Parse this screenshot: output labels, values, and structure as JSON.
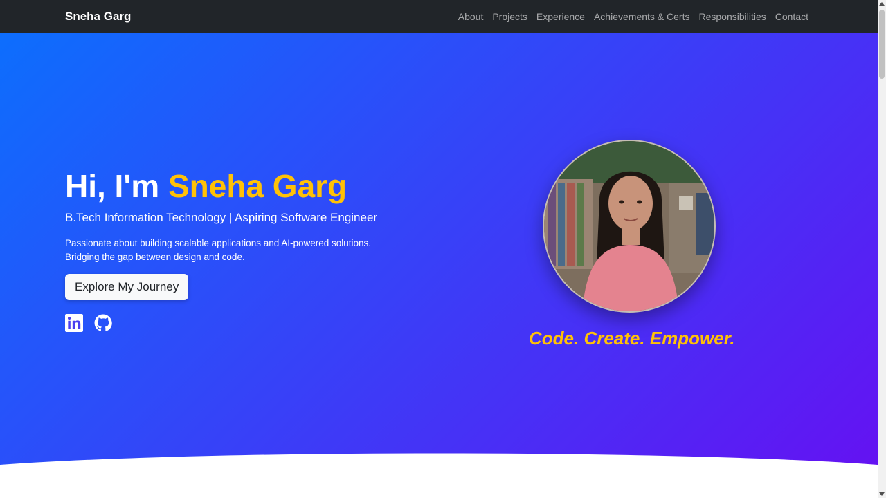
{
  "nav": {
    "brand": "Sneha Garg",
    "links": [
      "About",
      "Projects",
      "Experience",
      "Achievements & Certs",
      "Responsibilities",
      "Contact"
    ]
  },
  "hero": {
    "greeting": "Hi, I'm ",
    "name": "Sneha Garg",
    "subtitle": "B.Tech Information Technology | Aspiring Software Engineer",
    "description_line1": "Passionate about building scalable applications and AI-powered solutions.",
    "description_line2": "Bridging the gap between design and code.",
    "cta_label": "Explore My Journey",
    "socials": [
      "linkedin-icon",
      "github-icon"
    ],
    "tagline": "Code. Create. Empower."
  },
  "colors": {
    "navbar_bg": "#212529",
    "gradient_start": "#0d6efd",
    "gradient_end": "#6610f2",
    "accent": "#ffc107"
  }
}
